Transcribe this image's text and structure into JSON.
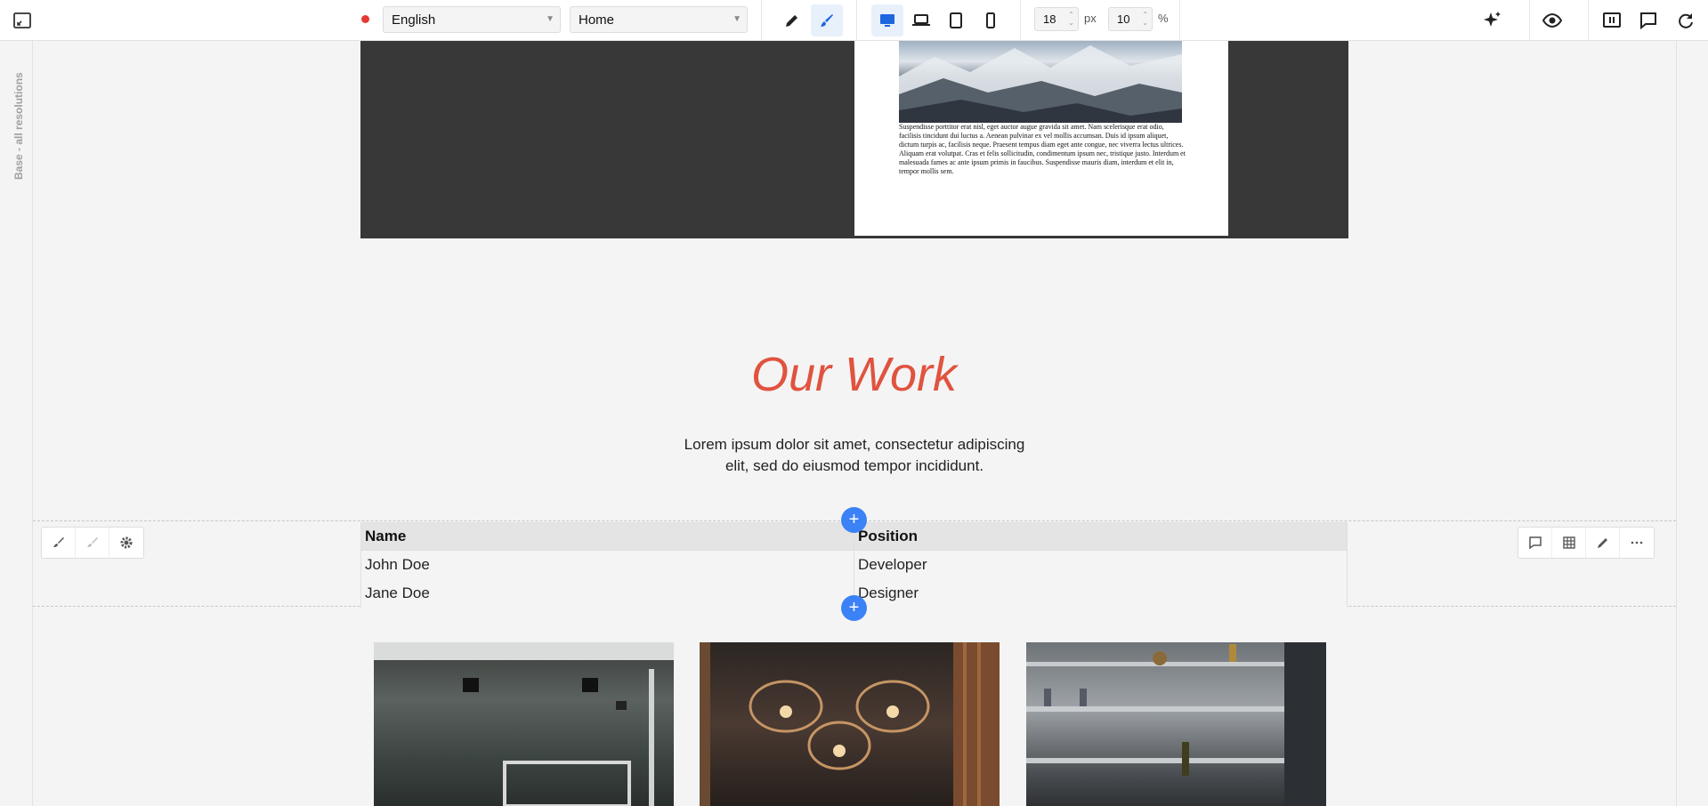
{
  "toolbar": {
    "language": "English",
    "page": "Home",
    "spacing_value": "18",
    "spacing_unit": "px",
    "percent_value": "10",
    "percent_unit": "%",
    "left_icons": [
      "expand-icon"
    ],
    "mode_icons": [
      "pencil-icon",
      "brush-icon"
    ],
    "device_icons": [
      "desktop-icon",
      "laptop-icon",
      "tablet-icon",
      "mobile-icon"
    ],
    "right_icons": [
      "ai-sparkle-icon",
      "preview-eye-icon",
      "panel-icon",
      "comment-icon",
      "refresh-icon"
    ],
    "active_device": "desktop",
    "status_color": "#e53935"
  },
  "sidebar": {
    "label": "Base - all resolutions"
  },
  "hero_card": {
    "text": "Suspendisse porttitor erat nisl, eget auctor augue gravida sit amet. Nam scelerisque erat odio, facilisis tincidunt dui luctus a. Aenean pulvinar ex vel mollis accumsan. Duis id ipsum aliquet, dictum turpis ac, facilisis neque. Praesent tempus diam eget ante congue, nec viverra lectus ultrices. Aliquam erat volutpat. Cras et felis sollicitudin, condimentum ipsum nec, tristique justo. Interdum et malesuada fames ac ante ipsum primis in faucibus. Suspendisse mauris diam, interdum et elit in, tempor mollis sem."
  },
  "section": {
    "heading": "Our Work",
    "lead_line1": "Lorem ipsum dolor sit amet, consectetur adipiscing",
    "lead_line2": "elit, sed do eiusmod tempor incididunt.",
    "heading_color": "#e0533f"
  },
  "table": {
    "headers": [
      "Name",
      "Position"
    ],
    "rows": [
      [
        "John Doe",
        "Developer"
      ],
      [
        "Jane Doe",
        "Designer"
      ]
    ]
  },
  "row_tools_left": [
    "brush-icon",
    "brush-light-icon",
    "gear-icon"
  ],
  "row_tools_right": [
    "comment-icon",
    "grid-icon",
    "pencil-icon",
    "more-icon"
  ],
  "add_button_label": "+",
  "accent_color": "#3b82f6"
}
